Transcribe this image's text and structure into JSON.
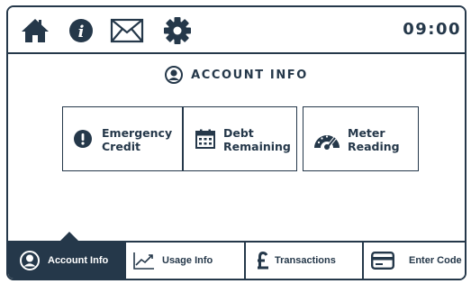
{
  "status_bar": {
    "time": "09:00"
  },
  "page": {
    "title": "ACCOUNT INFO"
  },
  "cards": [
    {
      "label": "Emergency\nCredit",
      "icon": "alert-icon"
    },
    {
      "label": "Debt\nRemaining",
      "icon": "calendar-icon"
    },
    {
      "label": "Meter\nReading",
      "icon": "gauge-icon"
    }
  ],
  "tabs": [
    {
      "label": "Account Info",
      "icon": "user-icon",
      "active": true
    },
    {
      "label": "Usage Info",
      "icon": "chart-line-icon",
      "active": false
    },
    {
      "label": "Transactions",
      "icon": "pound-icon",
      "active": false
    },
    {
      "label": "Enter Code",
      "icon": "card-icon",
      "active": false
    }
  ],
  "colors": {
    "primary": "#25384a",
    "background": "#ffffff"
  }
}
